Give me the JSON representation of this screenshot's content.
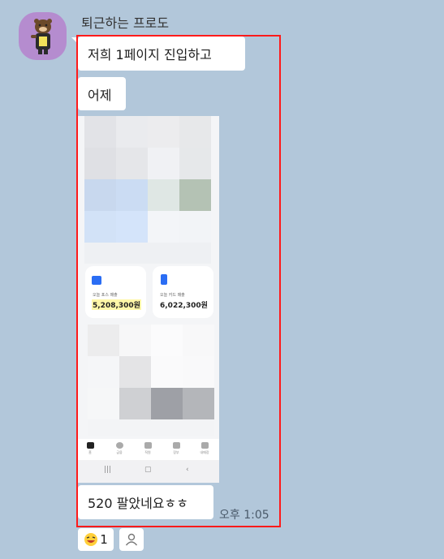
{
  "sender": {
    "name": "퇴근하는 프로도"
  },
  "messages": [
    {
      "text": "저희 1페이지 진입하고"
    },
    {
      "text": "어제"
    },
    {
      "text": "520 팔았네요ㅎㅎ",
      "time": "오후 1:05"
    }
  ],
  "screenshot": {
    "cards": [
      {
        "label": "오늘 포스 매출",
        "value": "5,208,300원"
      },
      {
        "label": "오늘 카드 매출",
        "value": "6,022,300원"
      }
    ],
    "nav": [
      "홈",
      "금융",
      "직원",
      "장부",
      "내매장"
    ]
  },
  "reactions": {
    "emoji_count": "1"
  },
  "colors": {
    "highlight": "#ff1a1a",
    "background": "#b2c7da"
  }
}
